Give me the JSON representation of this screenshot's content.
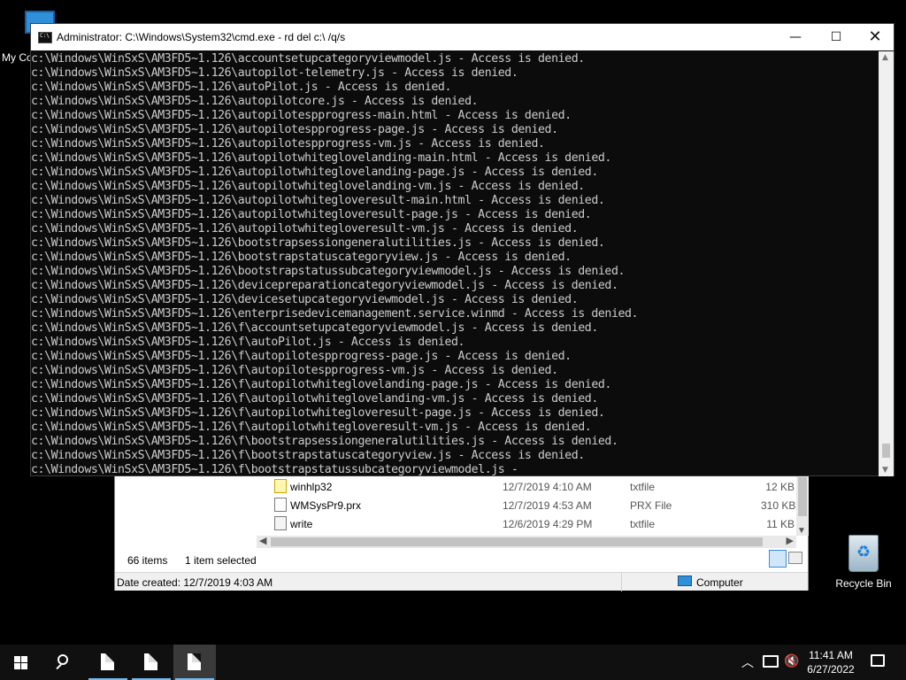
{
  "desktop": {
    "my_computer_label": "My Co",
    "recycle_bin_label": "Recycle Bin"
  },
  "cmd": {
    "title": "Administrator: C:\\Windows\\System32\\cmd.exe - rd  del c:\\ /q/s",
    "minimize": "—",
    "maximize": "☐",
    "close": "✕",
    "lines": [
      "c:\\Windows\\WinSxS\\AM3FD5~1.126\\accountsetupcategoryviewmodel.js - Access is denied.",
      "c:\\Windows\\WinSxS\\AM3FD5~1.126\\autopilot-telemetry.js - Access is denied.",
      "c:\\Windows\\WinSxS\\AM3FD5~1.126\\autoPilot.js - Access is denied.",
      "c:\\Windows\\WinSxS\\AM3FD5~1.126\\autopilotcore.js - Access is denied.",
      "c:\\Windows\\WinSxS\\AM3FD5~1.126\\autopilotespprogress-main.html - Access is denied.",
      "c:\\Windows\\WinSxS\\AM3FD5~1.126\\autopilotespprogress-page.js - Access is denied.",
      "c:\\Windows\\WinSxS\\AM3FD5~1.126\\autopilotespprogress-vm.js - Access is denied.",
      "c:\\Windows\\WinSxS\\AM3FD5~1.126\\autopilotwhiteglovelanding-main.html - Access is denied.",
      "c:\\Windows\\WinSxS\\AM3FD5~1.126\\autopilotwhiteglovelanding-page.js - Access is denied.",
      "c:\\Windows\\WinSxS\\AM3FD5~1.126\\autopilotwhiteglovelanding-vm.js - Access is denied.",
      "c:\\Windows\\WinSxS\\AM3FD5~1.126\\autopilotwhitegloveresult-main.html - Access is denied.",
      "c:\\Windows\\WinSxS\\AM3FD5~1.126\\autopilotwhitegloveresult-page.js - Access is denied.",
      "c:\\Windows\\WinSxS\\AM3FD5~1.126\\autopilotwhitegloveresult-vm.js - Access is denied.",
      "c:\\Windows\\WinSxS\\AM3FD5~1.126\\bootstrapsessiongeneralutilities.js - Access is denied.",
      "c:\\Windows\\WinSxS\\AM3FD5~1.126\\bootstrapstatuscategoryview.js - Access is denied.",
      "c:\\Windows\\WinSxS\\AM3FD5~1.126\\bootstrapstatussubcategoryviewmodel.js - Access is denied.",
      "c:\\Windows\\WinSxS\\AM3FD5~1.126\\devicepreparationcategoryviewmodel.js - Access is denied.",
      "c:\\Windows\\WinSxS\\AM3FD5~1.126\\devicesetupcategoryviewmodel.js - Access is denied.",
      "c:\\Windows\\WinSxS\\AM3FD5~1.126\\enterprisedevicemanagement.service.winmd - Access is denied.",
      "c:\\Windows\\WinSxS\\AM3FD5~1.126\\f\\accountsetupcategoryviewmodel.js - Access is denied.",
      "c:\\Windows\\WinSxS\\AM3FD5~1.126\\f\\autoPilot.js - Access is denied.",
      "c:\\Windows\\WinSxS\\AM3FD5~1.126\\f\\autopilotespprogress-page.js - Access is denied.",
      "c:\\Windows\\WinSxS\\AM3FD5~1.126\\f\\autopilotespprogress-vm.js - Access is denied.",
      "c:\\Windows\\WinSxS\\AM3FD5~1.126\\f\\autopilotwhiteglovelanding-page.js - Access is denied.",
      "c:\\Windows\\WinSxS\\AM3FD5~1.126\\f\\autopilotwhiteglovelanding-vm.js - Access is denied.",
      "c:\\Windows\\WinSxS\\AM3FD5~1.126\\f\\autopilotwhitegloveresult-page.js - Access is denied.",
      "c:\\Windows\\WinSxS\\AM3FD5~1.126\\f\\autopilotwhitegloveresult-vm.js - Access is denied.",
      "c:\\Windows\\WinSxS\\AM3FD5~1.126\\f\\bootstrapsessiongeneralutilities.js - Access is denied.",
      "c:\\Windows\\WinSxS\\AM3FD5~1.126\\f\\bootstrapstatuscategoryview.js - Access is denied.",
      "c:\\Windows\\WinSxS\\AM3FD5~1.126\\f\\bootstrapstatussubcategoryviewmodel.js -"
    ]
  },
  "explorer": {
    "files": [
      {
        "name": "winhlp32",
        "date": "12/7/2019 4:10 AM",
        "type": "txtfile",
        "size": "12 KB",
        "icon": "help-file-icon"
      },
      {
        "name": "WMSysPr9.prx",
        "date": "12/7/2019 4:53 AM",
        "type": "PRX File",
        "size": "310 KB",
        "icon": "file-icon"
      },
      {
        "name": "write",
        "date": "12/6/2019 4:29 PM",
        "type": "txtfile",
        "size": "11 KB",
        "icon": "write-file-icon"
      }
    ],
    "status_items": "66 items",
    "status_selected": "1 item selected",
    "details_date": "Date created: 12/7/2019 4:03 AM",
    "details_location": "Computer"
  },
  "taskbar": {
    "time": "11:41 AM",
    "date": "6/27/2022",
    "accent": "#76b9ed"
  }
}
